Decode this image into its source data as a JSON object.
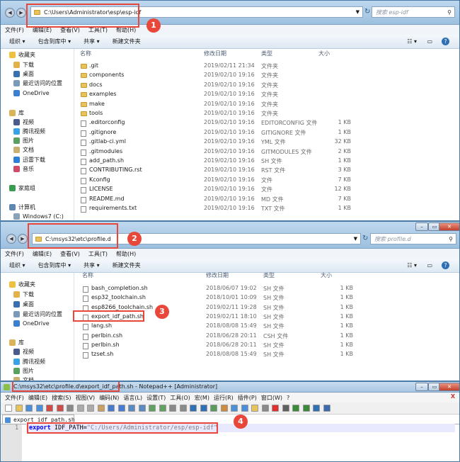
{
  "window1": {
    "address": "C:\\Users\\Administrator\\esp\\esp-idf",
    "search_placeholder": "搜索 esp-idf",
    "menu": [
      "文件(F)",
      "编辑(E)",
      "查看(V)",
      "工具(T)",
      "帮助(H)"
    ],
    "toolbar": [
      "组织 ▾",
      "包含到库中 ▾",
      "共享 ▾",
      "新建文件夹"
    ],
    "columns": {
      "name": "名称",
      "date": "修改日期",
      "type": "类型",
      "size": "大小"
    },
    "nav": [
      {
        "label": "收藏夹",
        "icon": "star-icon"
      },
      {
        "label": "下载",
        "icon": "download-folder-icon"
      },
      {
        "label": "桌面",
        "icon": "desktop-icon"
      },
      {
        "label": "最近访问的位置",
        "icon": "recent-places-icon"
      },
      {
        "label": "OneDrive",
        "icon": "cloud-icon"
      },
      {
        "label": "库",
        "icon": "library-icon"
      },
      {
        "label": "视频",
        "icon": "video-icon"
      },
      {
        "label": "腾讯视频",
        "icon": "tencent-video-icon"
      },
      {
        "label": "图片",
        "icon": "pictures-icon"
      },
      {
        "label": "文档",
        "icon": "documents-icon"
      },
      {
        "label": "迅雷下载",
        "icon": "thunder-download-icon"
      },
      {
        "label": "音乐",
        "icon": "music-icon"
      },
      {
        "label": "家庭组",
        "icon": "homegroup-icon"
      },
      {
        "label": "计算机",
        "icon": "computer-icon"
      },
      {
        "label": "Windows7 (C:)",
        "icon": "drive-icon"
      }
    ],
    "files": [
      {
        "name": ".git",
        "date": "2019/02/11 21:34",
        "type": "文件夹",
        "size": "",
        "kind": "folder"
      },
      {
        "name": "components",
        "date": "2019/02/10 19:16",
        "type": "文件夹",
        "size": "",
        "kind": "folder"
      },
      {
        "name": "docs",
        "date": "2019/02/10 19:16",
        "type": "文件夹",
        "size": "",
        "kind": "folder"
      },
      {
        "name": "examples",
        "date": "2019/02/10 19:16",
        "type": "文件夹",
        "size": "",
        "kind": "folder"
      },
      {
        "name": "make",
        "date": "2019/02/10 19:16",
        "type": "文件夹",
        "size": "",
        "kind": "folder"
      },
      {
        "name": "tools",
        "date": "2019/02/10 19:16",
        "type": "文件夹",
        "size": "",
        "kind": "folder"
      },
      {
        "name": ".editorconfig",
        "date": "2019/02/10 19:16",
        "type": "EDITORCONFIG 文件",
        "size": "1 KB",
        "kind": "file"
      },
      {
        "name": ".gitignore",
        "date": "2019/02/10 19:16",
        "type": "GITIGNORE 文件",
        "size": "1 KB",
        "kind": "file"
      },
      {
        "name": ".gitlab-ci.yml",
        "date": "2019/02/10 19:16",
        "type": "YML 文件",
        "size": "32 KB",
        "kind": "file"
      },
      {
        "name": ".gitmodules",
        "date": "2019/02/10 19:16",
        "type": "GITMODULES 文件",
        "size": "2 KB",
        "kind": "file"
      },
      {
        "name": "add_path.sh",
        "date": "2019/02/10 19:16",
        "type": "SH 文件",
        "size": "1 KB",
        "kind": "file"
      },
      {
        "name": "CONTRIBUTING.rst",
        "date": "2019/02/10 19:16",
        "type": "RST 文件",
        "size": "3 KB",
        "kind": "file"
      },
      {
        "name": "Kconfig",
        "date": "2019/02/10 19:16",
        "type": "文件",
        "size": "7 KB",
        "kind": "file"
      },
      {
        "name": "LICENSE",
        "date": "2019/02/10 19:16",
        "type": "文件",
        "size": "12 KB",
        "kind": "file"
      },
      {
        "name": "README.md",
        "date": "2019/02/10 19:16",
        "type": "MD 文件",
        "size": "7 KB",
        "kind": "file"
      },
      {
        "name": "requirements.txt",
        "date": "2019/02/10 19:16",
        "type": "TXT 文件",
        "size": "1 KB",
        "kind": "file"
      }
    ],
    "callout": "1"
  },
  "window2": {
    "address": "C:\\msys32\\etc\\profile.d",
    "search_placeholder": "搜索 profile.d",
    "menu": [
      "文件(F)",
      "编辑(E)",
      "查看(V)",
      "工具(T)",
      "帮助(H)"
    ],
    "toolbar": [
      "组织 ▾",
      "包含到库中 ▾",
      "共享 ▾",
      "新建文件夹"
    ],
    "columns": {
      "name": "名称",
      "date": "修改日期",
      "type": "类型",
      "size": "大小"
    },
    "nav": [
      {
        "label": "收藏夹",
        "icon": "star-icon"
      },
      {
        "label": "下载",
        "icon": "download-folder-icon"
      },
      {
        "label": "桌面",
        "icon": "desktop-icon"
      },
      {
        "label": "最近访问的位置",
        "icon": "recent-places-icon"
      },
      {
        "label": "OneDrive",
        "icon": "cloud-icon"
      },
      {
        "label": "库",
        "icon": "library-icon"
      },
      {
        "label": "视频",
        "icon": "video-icon"
      },
      {
        "label": "腾讯视频",
        "icon": "tencent-video-icon"
      },
      {
        "label": "图片",
        "icon": "pictures-icon"
      },
      {
        "label": "文档",
        "icon": "documents-icon"
      }
    ],
    "files": [
      {
        "name": "bash_completion.sh",
        "date": "2018/06/07 19:02",
        "type": "SH 文件",
        "size": "1 KB"
      },
      {
        "name": "esp32_toolchain.sh",
        "date": "2018/10/01 10:09",
        "type": "SH 文件",
        "size": "1 KB"
      },
      {
        "name": "esp8266_toolchain.sh",
        "date": "2019/02/11 19:28",
        "type": "SH 文件",
        "size": "1 KB"
      },
      {
        "name": "export_idf_path.sh",
        "date": "2019/02/11 18:10",
        "type": "SH 文件",
        "size": "1 KB"
      },
      {
        "name": "lang.sh",
        "date": "2018/08/08 15:49",
        "type": "SH 文件",
        "size": "1 KB"
      },
      {
        "name": "perlbin.csh",
        "date": "2018/06/28 20:11",
        "type": "CSH 文件",
        "size": "1 KB"
      },
      {
        "name": "perlbin.sh",
        "date": "2018/06/28 20:11",
        "type": "SH 文件",
        "size": "1 KB"
      },
      {
        "name": "tzset.sh",
        "date": "2018/08/08 15:49",
        "type": "SH 文件",
        "size": "1 KB"
      }
    ],
    "callout_address": "2",
    "callout_file": "3"
  },
  "notepad": {
    "title": "C:\\msys32\\etc\\profile.d\\export_idf_path.sh - Notepad++ [Administrator]",
    "menu": [
      "文件(F)",
      "编辑(E)",
      "搜索(S)",
      "视图(V)",
      "编码(N)",
      "语言(L)",
      "设置(T)",
      "工具(O)",
      "宏(M)",
      "运行(R)",
      "插件(P)",
      "窗口(W)",
      "?"
    ],
    "close_x": "X",
    "tab": "export_idf_path.sh",
    "line_number": "1",
    "code_keyword": "export",
    "code_var": " IDF_PATH=",
    "code_string": "\"C:/Users/Administrator/esp/esp-idf\"",
    "callout": "4"
  },
  "colors": {
    "callout": "#e8473a",
    "keyword": "#0000ff",
    "string": "#808080"
  }
}
